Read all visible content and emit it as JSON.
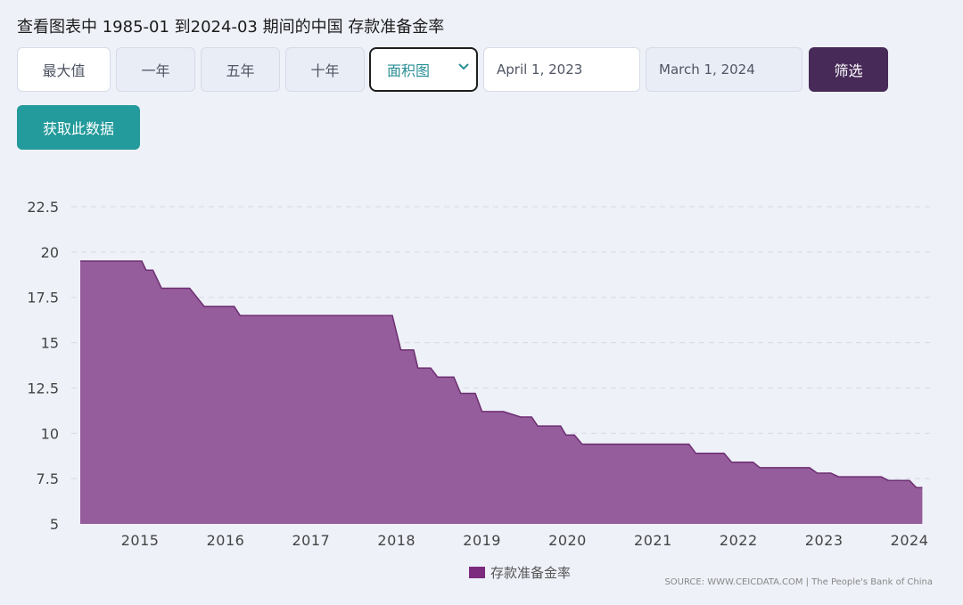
{
  "header": {
    "title": "查看图表中 1985-01 到2024-03 期间的中国 存款准备金率"
  },
  "toolbar": {
    "range_buttons": [
      "最大值",
      "一年",
      "五年",
      "十年"
    ],
    "chart_type_select": {
      "selected": "面积图"
    },
    "start_date": "April 1, 2023",
    "end_date": "March 1, 2024",
    "filter_label": "筛选",
    "get_data_label": "获取此数据"
  },
  "chart_data": {
    "type": "area",
    "ylim": [
      5,
      22.5
    ],
    "yticks": [
      5,
      7.5,
      10,
      12.5,
      15,
      17.5,
      20,
      22.5
    ],
    "ytick_labels": [
      "5",
      "7.5",
      "10",
      "12.5",
      "15",
      "17.5",
      "20",
      "22.5"
    ],
    "xlim": [
      2014.3,
      2024.25
    ],
    "xticks": [
      2015,
      2016,
      2017,
      2018,
      2019,
      2020,
      2021,
      2022,
      2023,
      2024
    ],
    "xtick_labels": [
      "2015",
      "2016",
      "2017",
      "2018",
      "2019",
      "2020",
      "2021",
      "2022",
      "2023",
      "2024"
    ],
    "grid": true,
    "color": "#955d9c",
    "edge_color": "#6e2f72",
    "series": [
      {
        "name": "存款准备金率",
        "points": [
          [
            2014.3,
            19.5
          ],
          [
            2015.02,
            19.5
          ],
          [
            2015.07,
            19.0
          ],
          [
            2015.15,
            19.0
          ],
          [
            2015.25,
            18.0
          ],
          [
            2015.58,
            18.0
          ],
          [
            2015.75,
            17.0
          ],
          [
            2016.1,
            17.0
          ],
          [
            2016.17,
            16.5
          ],
          [
            2017.95,
            16.5
          ],
          [
            2018.05,
            14.6
          ],
          [
            2018.2,
            14.6
          ],
          [
            2018.25,
            13.6
          ],
          [
            2018.4,
            13.6
          ],
          [
            2018.48,
            13.1
          ],
          [
            2018.67,
            13.1
          ],
          [
            2018.75,
            12.2
          ],
          [
            2018.92,
            12.2
          ],
          [
            2019.0,
            11.2
          ],
          [
            2019.25,
            11.2
          ],
          [
            2019.45,
            10.9
          ],
          [
            2019.58,
            10.9
          ],
          [
            2019.65,
            10.4
          ],
          [
            2019.92,
            10.4
          ],
          [
            2019.98,
            9.9
          ],
          [
            2020.08,
            9.9
          ],
          [
            2020.17,
            9.4
          ],
          [
            2021.42,
            9.4
          ],
          [
            2021.5,
            8.9
          ],
          [
            2021.83,
            8.9
          ],
          [
            2021.92,
            8.4
          ],
          [
            2022.17,
            8.4
          ],
          [
            2022.25,
            8.1
          ],
          [
            2022.83,
            8.1
          ],
          [
            2022.92,
            7.8
          ],
          [
            2023.08,
            7.8
          ],
          [
            2023.17,
            7.6
          ],
          [
            2023.67,
            7.6
          ],
          [
            2023.75,
            7.4
          ],
          [
            2024.0,
            7.4
          ],
          [
            2024.08,
            7.0
          ],
          [
            2024.15,
            7.0
          ]
        ]
      }
    ]
  },
  "legend": {
    "label": "存款准备金率",
    "color": "#7b2a7d"
  },
  "source": "SOURCE: WWW.CEICDATA.COM | The People's Bank of China"
}
